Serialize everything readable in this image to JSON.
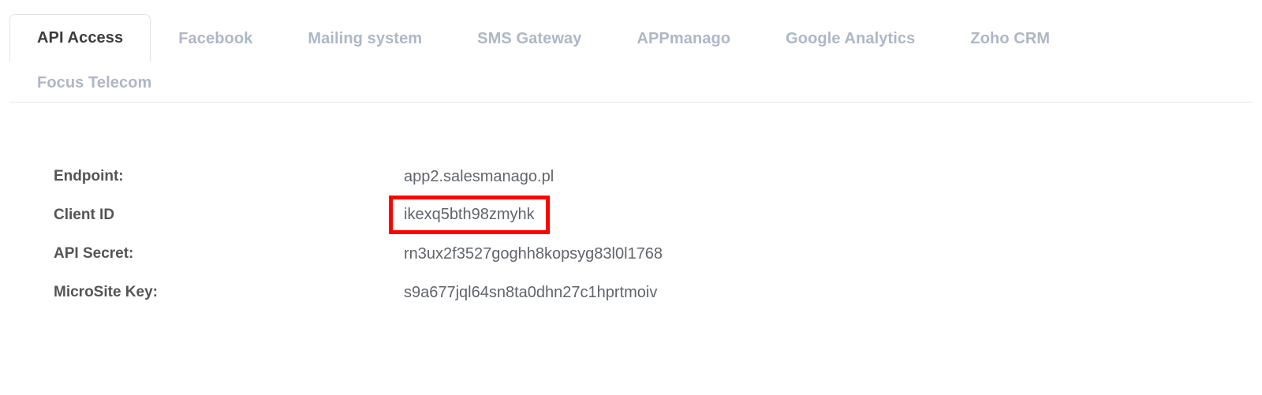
{
  "tabs": {
    "row1": [
      {
        "label": "API Access",
        "active": true
      },
      {
        "label": "Facebook",
        "active": false
      },
      {
        "label": "Mailing system",
        "active": false
      },
      {
        "label": "SMS Gateway",
        "active": false
      },
      {
        "label": "APPmanago",
        "active": false
      },
      {
        "label": "Google Analytics",
        "active": false
      },
      {
        "label": "Zoho CRM",
        "active": false
      }
    ],
    "row2": [
      {
        "label": "Focus Telecom",
        "active": false
      }
    ],
    "active_tab": "API Access",
    "active_color": "#3c3c3c",
    "inactive_color": "#aeb7c6",
    "border_color": "#e2e2e2"
  },
  "fields": [
    {
      "label": "Endpoint:",
      "value": "app2.salesmanago.pl",
      "highlighted": false
    },
    {
      "label": "Client ID",
      "value": "ikexq5bth98zmyhk",
      "highlighted": true
    },
    {
      "label": "API Secret:",
      "value": "rn3ux2f3527goghh8kopsyg83l0l1768",
      "highlighted": false
    },
    {
      "label": "MicroSite Key:",
      "value": "s9a677jql64sn8ta0dhn27c1hprtmoiv",
      "highlighted": false
    }
  ],
  "highlight": {
    "color": "#ff0000",
    "target": "Client ID"
  }
}
